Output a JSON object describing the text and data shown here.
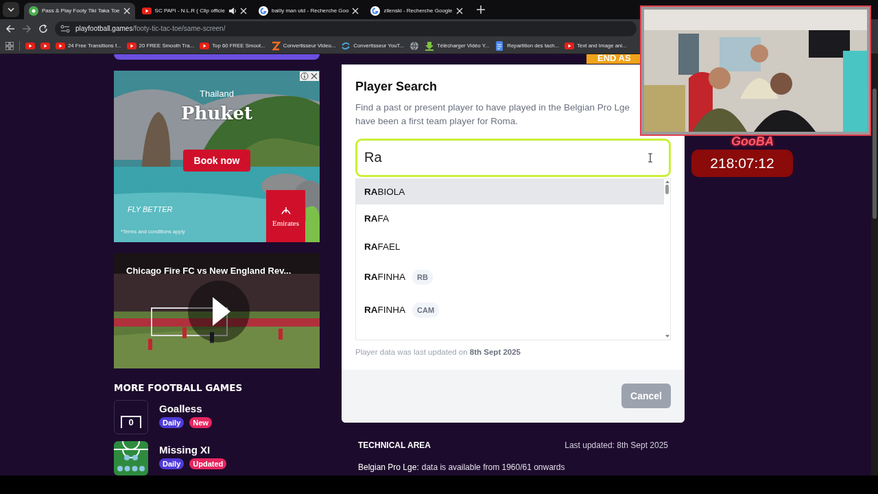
{
  "browser": {
    "tabs": [
      {
        "title": "Pass & Play Footy Tiki Taka Toe",
        "kind": "site",
        "selected": true,
        "audio": false
      },
      {
        "title": "SC PAPI - N.L.R ( Clip officie",
        "kind": "youtube",
        "selected": false,
        "audio": true
      },
      {
        "title": "bailly man utd - Recherche Goo",
        "kind": "google",
        "selected": false,
        "audio": false
      },
      {
        "title": "zilenski - Recherche Google",
        "kind": "google",
        "selected": false,
        "audio": false
      }
    ],
    "url": {
      "host": "playfootball.games",
      "path": "/footy-tic-tac-toe/same-screen/"
    },
    "bookmarks": [
      {
        "kind": "youtube"
      },
      {
        "kind": "youtube"
      },
      {
        "kind": "youtube",
        "label": "24 Free Transitions f..."
      },
      {
        "kind": "youtube",
        "label": "20 FREE Smooth Tra..."
      },
      {
        "kind": "youtube",
        "label": "Top 60 FREE Smoot..."
      },
      {
        "kind": "z",
        "label": "Convertisseur Video..."
      },
      {
        "kind": "swirl",
        "label": "Convertisseur YouT..."
      },
      {
        "kind": "globe"
      },
      {
        "kind": "download",
        "label": "Télécharger Vidéo Y..."
      },
      {
        "kind": "doc",
        "label": "Repartition des tach..."
      },
      {
        "kind": "youtube",
        "label": "Text and Image ani..."
      }
    ]
  },
  "ad": {
    "kind": "picture",
    "kicker": "Thailand",
    "headline": "Phuket",
    "button": "Book now",
    "slogan": "FLY BETTER",
    "brand": "Emirates",
    "terms": "*Terms and conditions apply"
  },
  "video": {
    "kind": "picture",
    "title": "Chicago Fire FC vs New England Rev..."
  },
  "more_games": {
    "heading": "MORE FOOTBALL GAMES",
    "games": [
      {
        "title": "Goalless",
        "kind": "goal",
        "icon_text": "0",
        "tags": [
          {
            "label": "Daily",
            "color": "#4f3bd8"
          },
          {
            "label": "New",
            "color": "#e5265f"
          }
        ]
      },
      {
        "title": "Missing XI",
        "kind": "pitch",
        "tags": [
          {
            "label": "Daily",
            "color": "#4f3bd8"
          },
          {
            "label": "Updated",
            "color": "#e5265f"
          }
        ]
      }
    ]
  },
  "banner": {
    "label": "END AS"
  },
  "dialog": {
    "title": "Player Search",
    "description": [
      "Find a past or present player to have played in the Belgian Pro Lge",
      "have been a first team player for Roma."
    ],
    "search": {
      "value": "Ra"
    },
    "results": [
      {
        "name": "**RA**BIOLA",
        "selected": true
      },
      {
        "name": "**RA**FA",
        "selected": false
      },
      {
        "name": "**RA**FAEL",
        "selected": false
      },
      {
        "name": "**RA**FINHA",
        "position": "RB",
        "selected": false
      },
      {
        "name": "**RA**FINHA",
        "position": "CAM",
        "selected": false
      }
    ],
    "note": "Player data was last updated on **8th Sept 2025**",
    "cancel": "Cancel"
  },
  "technical_area": {
    "heading": "TECHNICAL AREA",
    "updated": "Last updated: 8th Sept 2025",
    "league": "Belgian Pro Lge:",
    "availability": "data is available from 1960/61 onwards"
  },
  "stream_overlay": {
    "kind": "picture",
    "logo": "GooBA",
    "timer": "218:07:12"
  }
}
